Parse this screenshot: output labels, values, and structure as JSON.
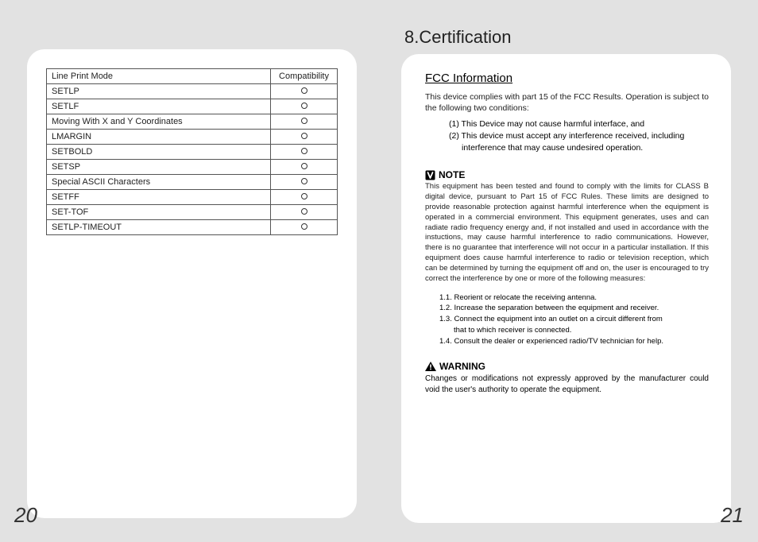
{
  "left": {
    "page_number": "20",
    "table": {
      "header_left": "Line Print Mode",
      "header_right": "Compatibility",
      "rows": [
        "SETLP",
        "SETLF",
        "Moving With X and Y Coordinates",
        "LMARGIN",
        "SETBOLD",
        "SETSP",
        "Special ASCII Characters",
        "SETFF",
        "SET-TOF",
        "SETLP-TIMEOUT"
      ]
    }
  },
  "right": {
    "page_number": "21",
    "section_title": "8.Certification",
    "fcc_title": "FCC Information",
    "intro": "This device complies with part 15 of the FCC Results. Operation is subject to the following two conditions:",
    "cond1": "(1) This Device may not cause harmful interface, and",
    "cond2a": "(2) This device must accept any interference received, including",
    "cond2b": "interference that may cause undesired operation.",
    "note_label": "NOTE",
    "note_body": "This equipment has been tested and found to comply with the limits for CLASS B digital device, pursuant to Part 15 of FCC Rules. These limits are designed to provide reasonable protection against harmful interference when the equipment is operated in a commercial environment. This equipment generates, uses and can radiate radio frequency energy and, if not installed and used in accordance with the instuctions, may cause harmful interference to radio communications. However, there is no guarantee that interference will not occur in a particular installation. If this equipment does cause harmful interference to radio or television reception, which can be determined by turning the equipment off and on, the user is encouraged to try correct the interference by one or more of the following measures:",
    "m1": "1.1. Reorient or relocate the receiving antenna.",
    "m2": "1.2. Increase the separation between the equipment and receiver.",
    "m3a": "1.3. Connect the equipment into an outlet on a circuit different from",
    "m3b": "that to which receiver is connected.",
    "m4": "1.4. Consult the dealer or experienced radio/TV technician for help.",
    "warn_label": "WARNING",
    "warn_body": "Changes or modifications not expressly approved by the manufacturer could void the user's authority to operate the equipment."
  }
}
